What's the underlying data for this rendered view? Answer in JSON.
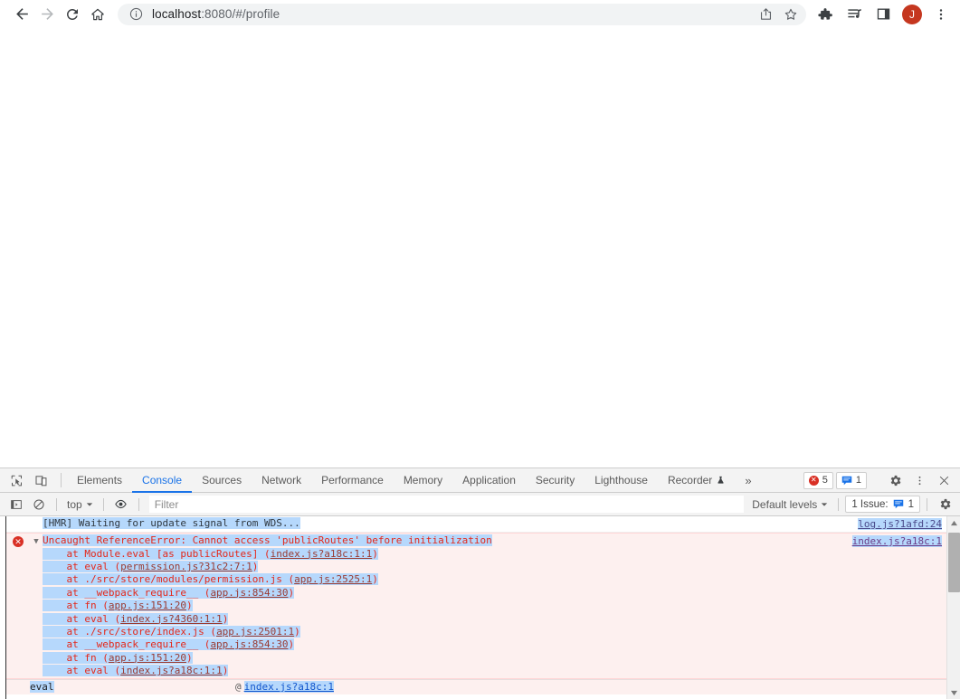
{
  "browser": {
    "nav": {
      "back_label": "Back",
      "forward_label": "Forward",
      "reload_label": "Reload",
      "home_label": "Home"
    },
    "omnibox": {
      "info_icon": "info-circle-icon",
      "host": "localhost",
      "path": ":8080/#/profile",
      "full_url": "localhost:8080/#/profile",
      "share_icon": "share-icon",
      "bookmark_icon": "star-icon"
    },
    "toolbar_icons": [
      {
        "name": "extensions-puzzle-icon",
        "label": "Extensions"
      },
      {
        "name": "media-playlist-icon",
        "label": "Media controls"
      },
      {
        "name": "side-panel-icon",
        "label": "Side panel"
      }
    ],
    "avatar": {
      "initial": "J",
      "color": "#c5371f"
    },
    "menu_icon": "kebab-menu-icon"
  },
  "devtools": {
    "left_icons": [
      {
        "name": "inspect-element-icon",
        "label": "Inspect element"
      },
      {
        "name": "device-toolbar-icon",
        "label": "Toggle device toolbar"
      }
    ],
    "tabs": [
      {
        "label": "Elements",
        "active": false
      },
      {
        "label": "Console",
        "active": true
      },
      {
        "label": "Sources",
        "active": false
      },
      {
        "label": "Network",
        "active": false
      },
      {
        "label": "Performance",
        "active": false
      },
      {
        "label": "Memory",
        "active": false
      },
      {
        "label": "Application",
        "active": false
      },
      {
        "label": "Security",
        "active": false
      },
      {
        "label": "Lighthouse",
        "active": false
      },
      {
        "label": "Recorder",
        "active": false,
        "icon": "flask-icon"
      }
    ],
    "overflow_label": "»",
    "error_count": "5",
    "message_count": "1",
    "settings_icon": "gear-icon",
    "more_icon": "kebab-menu-icon",
    "close_icon": "close-icon"
  },
  "console_toolbar": {
    "sidebar_toggle_icon": "console-sidebar-icon",
    "clear_icon": "clear-console-icon",
    "context_label": "top",
    "eye_icon": "live-expression-eye-icon",
    "filter_placeholder": "Filter",
    "filter_value": "",
    "levels_label": "Default levels",
    "issues_label": "1 Issue:",
    "issues_count": "1",
    "settings_icon": "gear-icon"
  },
  "console_messages": [
    {
      "type": "info",
      "text": "[HMR] Waiting for update signal from WDS...",
      "source": "log.js?1afd:24",
      "selected": true
    },
    {
      "type": "error",
      "icon": "error-circle-icon",
      "expanded": true,
      "text": "Uncaught ReferenceError: Cannot access 'publicRoutes' before initialization",
      "source": "index.js?a18c:1",
      "selected": true,
      "stack": [
        {
          "prefix": "    at Module.eval [as publicRoutes] (",
          "url": "index.js?a18c:1:1",
          "suffix": ")"
        },
        {
          "prefix": "    at eval (",
          "url": "permission.js?31c2:7:1",
          "suffix": ")"
        },
        {
          "prefix": "    at ./src/store/modules/permission.js (",
          "url": "app.js:2525:1",
          "suffix": ")"
        },
        {
          "prefix": "    at __webpack_require__ (",
          "url": "app.js:854:30",
          "suffix": ")"
        },
        {
          "prefix": "    at fn (",
          "url": "app.js:151:20",
          "suffix": ")"
        },
        {
          "prefix": "    at eval (",
          "url": "index.js?4360:1:1",
          "suffix": ")"
        },
        {
          "prefix": "    at ./src/store/index.js (",
          "url": "app.js:2501:1",
          "suffix": ")"
        },
        {
          "prefix": "    at __webpack_require__ (",
          "url": "app.js:854:30",
          "suffix": ")"
        },
        {
          "prefix": "    at fn (",
          "url": "app.js:151:20",
          "suffix": ")"
        },
        {
          "prefix": "    at eval (",
          "url": "index.js?a18c:1:1",
          "suffix": ")"
        }
      ]
    }
  ],
  "console_anchor": {
    "name": "eval",
    "at": "@",
    "link": "index.js?a18c:1"
  },
  "colors": {
    "accent": "#1a73e8",
    "error_text": "#e4281a",
    "error_bg": "#fdf0ef",
    "selection": "#b6d8fc",
    "avatar": "#c5371f"
  }
}
